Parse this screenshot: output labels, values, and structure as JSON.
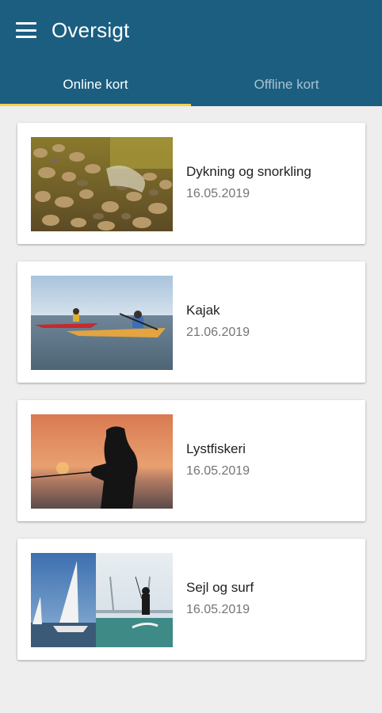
{
  "appbar": {
    "title": "Oversigt",
    "menu_icon": "hamburger-menu-icon",
    "color": "#1b5e80"
  },
  "tabs": [
    {
      "label": "Online kort",
      "active": true
    },
    {
      "label": "Offline kort",
      "active": false
    }
  ],
  "tab_indicator_color": "#f2d14b",
  "cards": [
    {
      "title": "Dykning og snorkling",
      "date": "16.05.2019"
    },
    {
      "title": "Kajak",
      "date": "21.06.2019"
    },
    {
      "title": "Lystfiskeri",
      "date": "16.05.2019"
    },
    {
      "title": "Sejl og surf",
      "date": "16.05.2019"
    }
  ]
}
